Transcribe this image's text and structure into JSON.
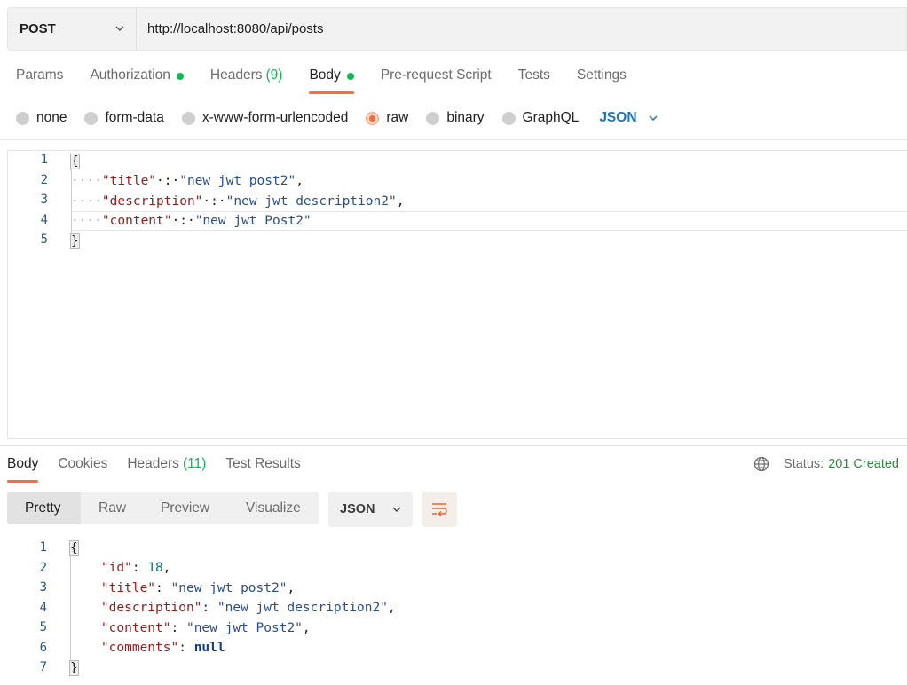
{
  "request": {
    "method": "POST",
    "url": "http://localhost:8080/api/posts",
    "tabs": [
      {
        "label": "Params"
      },
      {
        "label": "Authorization",
        "dot": true
      },
      {
        "label": "Headers",
        "count": "(9)"
      },
      {
        "label": "Body",
        "dot": true,
        "active": true
      },
      {
        "label": "Pre-request Script"
      },
      {
        "label": "Tests"
      },
      {
        "label": "Settings"
      }
    ],
    "body_modes": [
      "none",
      "form-data",
      "x-www-form-urlencoded",
      "raw",
      "binary",
      "GraphQL"
    ],
    "selected_mode": "raw",
    "language": "JSON",
    "body_lines": [
      {
        "n": "1",
        "text": "{"
      },
      {
        "n": "2",
        "key": "\"title\"",
        "value": "\"new jwt post2\""
      },
      {
        "n": "3",
        "key": "\"description\"",
        "value": "\"new jwt description2\""
      },
      {
        "n": "4",
        "key": "\"content\"",
        "value": "\"new jwt Post2\""
      },
      {
        "n": "5",
        "text": "}"
      }
    ]
  },
  "response": {
    "tabs": [
      {
        "label": "Body",
        "active": true
      },
      {
        "label": "Cookies"
      },
      {
        "label": "Headers",
        "count": "(11)"
      },
      {
        "label": "Test Results"
      }
    ],
    "status_label": "Status:",
    "status_value": "201 Created",
    "view_modes": [
      "Pretty",
      "Raw",
      "Preview",
      "Visualize"
    ],
    "selected_view": "Pretty",
    "format": "JSON",
    "body_lines": [
      {
        "n": "1",
        "text": "{"
      },
      {
        "n": "2",
        "key": "\"id\"",
        "value": "18",
        "type": "number"
      },
      {
        "n": "3",
        "key": "\"title\"",
        "value": "\"new jwt post2\"",
        "type": "string"
      },
      {
        "n": "4",
        "key": "\"description\"",
        "value": "\"new jwt description2\"",
        "type": "string"
      },
      {
        "n": "5",
        "key": "\"content\"",
        "value": "\"new jwt Post2\"",
        "type": "string"
      },
      {
        "n": "6",
        "key": "\"comments\"",
        "value": "null",
        "type": "null"
      },
      {
        "n": "7",
        "text": "}"
      }
    ]
  },
  "colors": {
    "accent": "#ff6c37",
    "success": "#0cbb52",
    "link": "#1a73c7",
    "json_key": "#9a1a1a",
    "json_string": "#2a4e8f",
    "json_number": "#0b7d6a"
  },
  "icons": [
    "chevron-down-icon",
    "globe-icon",
    "wrap-lines-icon"
  ]
}
